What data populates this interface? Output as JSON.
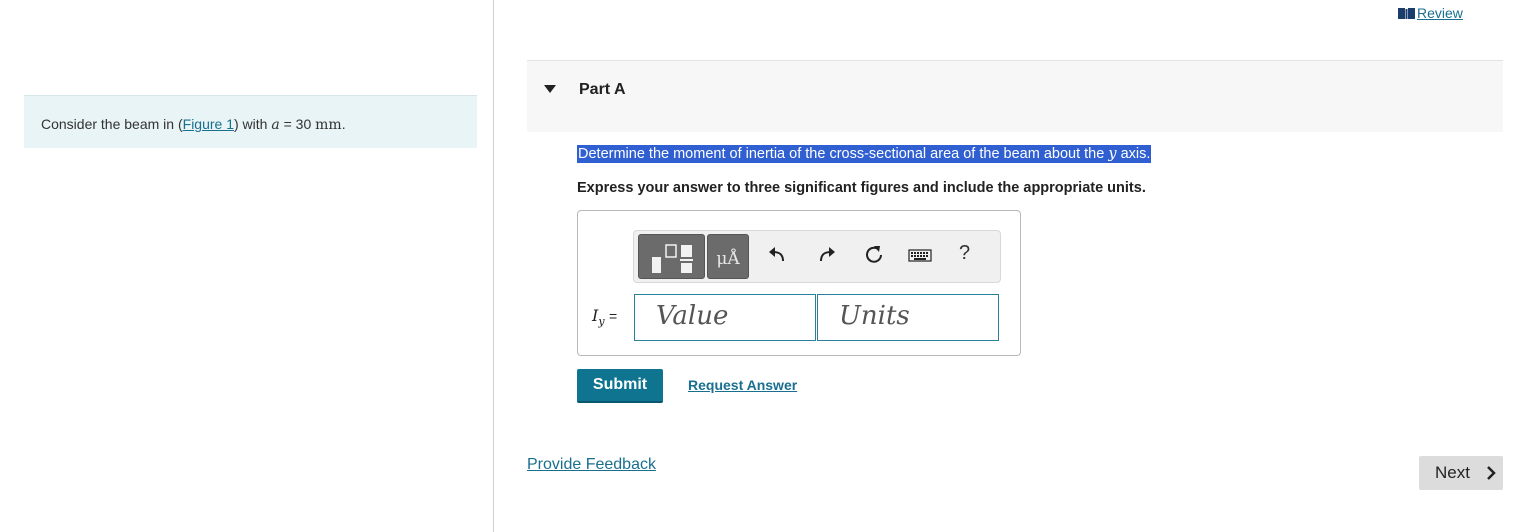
{
  "header": {
    "review_label": "Review"
  },
  "left_panel": {
    "text_before": "Consider the beam in (",
    "figure_link": "Figure 1",
    "text_after": ") with ",
    "var": "a",
    "equals": " = 30 ",
    "unit": "mm",
    "period": "."
  },
  "part": {
    "title": "Part A"
  },
  "question": {
    "text": "Determine the moment of inertia of the cross-sectional area of the beam about the ",
    "axis_var": "y",
    "text_end": " axis.",
    "instruction": "Express your answer to three significant figures and include the appropriate units."
  },
  "toolbar": {
    "units_btn": "μÅ",
    "icons": [
      "templates-icon",
      "units-icon",
      "undo-icon",
      "redo-icon",
      "reset-icon",
      "keyboard-icon",
      "help-icon"
    ],
    "help_label": "?"
  },
  "answer": {
    "var_main": "I",
    "var_sub": "y",
    "equals": "=",
    "value_placeholder": "Value",
    "units_placeholder": "Units"
  },
  "actions": {
    "submit_label": "Submit",
    "request_label": "Request Answer",
    "feedback_label": "Provide Feedback",
    "next_label": "Next"
  },
  "colors": {
    "accent": "#0e7490",
    "link": "#1a6f8f",
    "highlight": "#2f5fd0",
    "panel_bg": "#e8f4f5"
  }
}
